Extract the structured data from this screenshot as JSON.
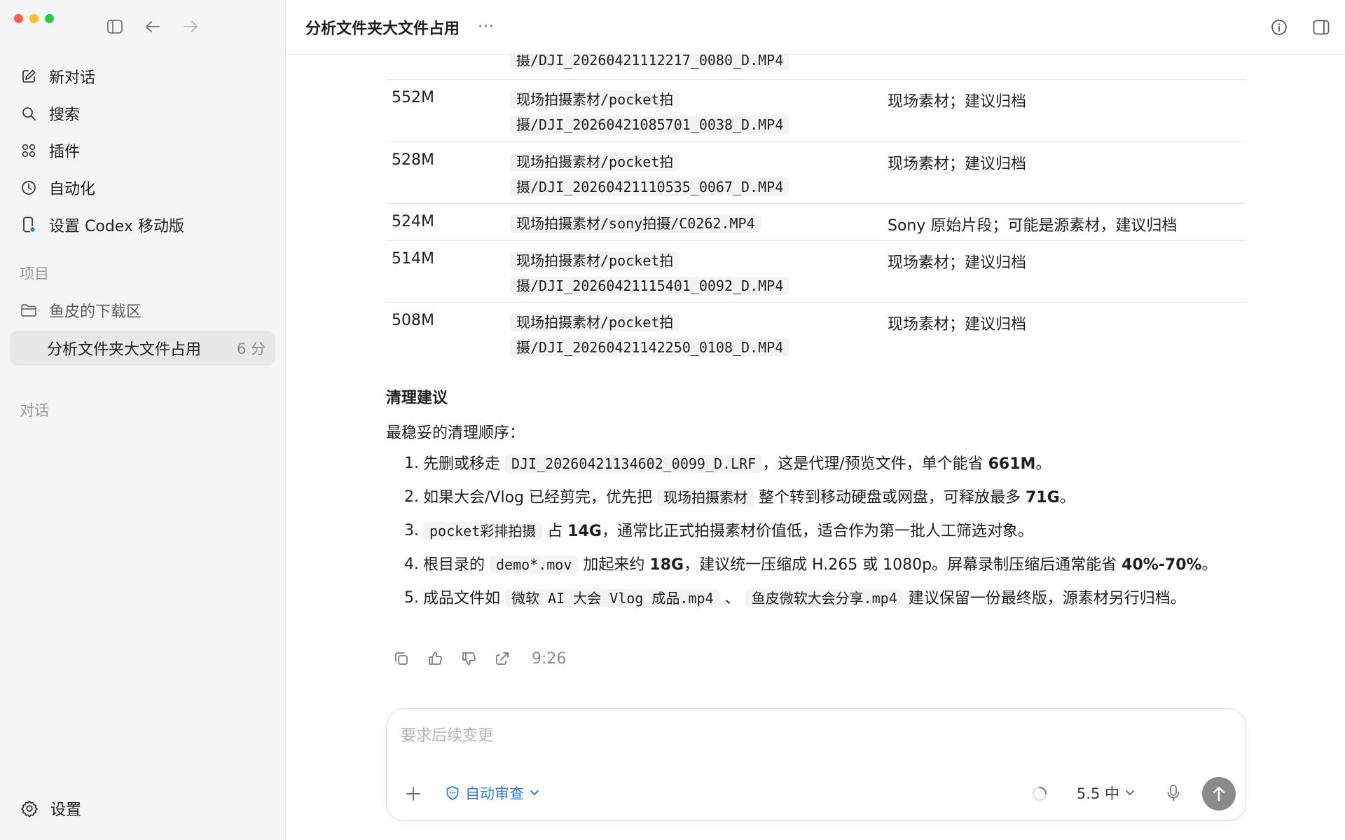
{
  "sidebar": {
    "nav": [
      {
        "label": "新对话",
        "icon": "edit-icon"
      },
      {
        "label": "搜索",
        "icon": "search-icon"
      },
      {
        "label": "插件",
        "icon": "grid-icon"
      },
      {
        "label": "自动化",
        "icon": "clock-icon"
      },
      {
        "label": "设置 Codex 移动版",
        "icon": "phone-icon"
      }
    ],
    "projects_label": "项目",
    "project_name": "鱼皮的下载区",
    "active_thread": {
      "title": "分析文件夹大文件占用",
      "time": "6 分"
    },
    "chats_label": "对话",
    "settings_label": "设置"
  },
  "header": {
    "title": "分析文件夹大文件占用",
    "more": "···"
  },
  "table": {
    "top_partial": {
      "path": "摄/DJI_20260421112217_0080_D.MP4"
    },
    "rows": [
      {
        "size": "552M",
        "path_a": "现场拍摄素材/pocket拍",
        "path_b": "摄/DJI_20260421085701_0038_D.MP4",
        "note": "现场素材；建议归档"
      },
      {
        "size": "528M",
        "path_a": "现场拍摄素材/pocket拍",
        "path_b": "摄/DJI_20260421110535_0067_D.MP4",
        "note": "现场素材；建议归档"
      },
      {
        "size": "524M",
        "path_a": "现场拍摄素材/sony拍摄/C0262.MP4",
        "path_b": "",
        "note": "Sony 原始片段；可能是源素材，建议归档"
      },
      {
        "size": "514M",
        "path_a": "现场拍摄素材/pocket拍",
        "path_b": "摄/DJI_20260421115401_0092_D.MP4",
        "note": "现场素材；建议归档"
      },
      {
        "size": "508M",
        "path_a": "现场拍摄素材/pocket拍",
        "path_b": "摄/DJI_20260421142250_0108_D.MP4",
        "note": "现场素材；建议归档"
      }
    ]
  },
  "cleanup": {
    "heading": "清理建议",
    "intro": "最稳妥的清理顺序：",
    "steps": [
      {
        "num": "1.",
        "t1": "先删或移走 ",
        "code1": "DJI_20260421134602_0099_D.LRF",
        "t2": "，这是代理/预览文件，单个能省 ",
        "b1": "661M",
        "t3": "。"
      },
      {
        "num": "2.",
        "t1": "如果大会/Vlog 已经剪完，优先把 ",
        "code1": "现场拍摄素材",
        "t2": " 整个转到移动硬盘或网盘，可释放最多 ",
        "b1": "71G",
        "t3": "。"
      },
      {
        "num": "3.",
        "code1": "pocket彩排拍摄",
        "t1": " 占 ",
        "b1": "14G",
        "t2": "，通常比正式拍摄素材价值低，适合作为第一批人工筛选对象。"
      },
      {
        "num": "4.",
        "t1": "根目录的 ",
        "code1": "demo*.mov",
        "t2": " 加起来约 ",
        "b1": "18G",
        "t3": "，建议统一压缩成 H.265 或 1080p。屏幕录制压缩后通常能省 ",
        "b2": "40%-70%",
        "t4": "。"
      },
      {
        "num": "5.",
        "t1": "成品文件如 ",
        "code1": "微软 AI 大会 Vlog 成品.mp4",
        "t2": " 、 ",
        "code2": "鱼皮微软大会分享.mp4",
        "t3": " 建议保留一份最终版，源素材另行归档。"
      }
    ]
  },
  "message_actions": {
    "time": "9:26"
  },
  "composer": {
    "placeholder": "要求后续变更",
    "review_label": "自动审查",
    "model_label": "5.5 中"
  }
}
